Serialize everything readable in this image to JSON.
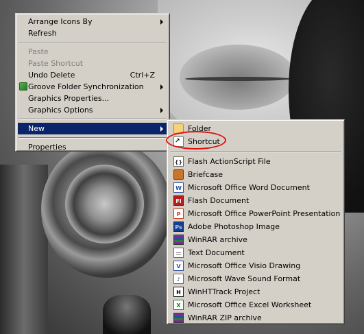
{
  "main_menu": {
    "items": [
      {
        "label": "Arrange Icons By",
        "submenu": true
      },
      {
        "label": "Refresh"
      },
      {
        "label": "Paste",
        "disabled": true
      },
      {
        "label": "Paste Shortcut",
        "disabled": true
      },
      {
        "label": "Undo Delete",
        "shortcut": "Ctrl+Z"
      },
      {
        "label": "Groove Folder Synchronization",
        "submenu": true,
        "icon": "groove-icon"
      },
      {
        "label": "Graphics Properties..."
      },
      {
        "label": "Graphics Options",
        "submenu": true
      },
      {
        "label": "New",
        "submenu": true,
        "selected": true
      },
      {
        "label": "Properties"
      }
    ]
  },
  "new_submenu": {
    "items": [
      {
        "label": "Folder",
        "icon": "folder-icon"
      },
      {
        "label": "Shortcut",
        "icon": "shortcut-icon",
        "highlighted_annotation": true
      },
      {
        "label": "Flash ActionScript File",
        "icon": "actionscript-file-icon"
      },
      {
        "label": "Briefcase",
        "icon": "briefcase-icon"
      },
      {
        "label": "Microsoft Office Word Document",
        "icon": "word-document-icon"
      },
      {
        "label": "Flash Document",
        "icon": "flash-document-icon"
      },
      {
        "label": "Microsoft Office PowerPoint Presentation",
        "icon": "powerpoint-icon"
      },
      {
        "label": "Adobe Photoshop Image",
        "icon": "photoshop-icon"
      },
      {
        "label": "WinRAR archive",
        "icon": "winrar-icon"
      },
      {
        "label": "Text Document",
        "icon": "text-document-icon"
      },
      {
        "label": "Microsoft Office Visio Drawing",
        "icon": "visio-icon"
      },
      {
        "label": "Microsoft Wave Sound Format",
        "icon": "wave-sound-icon"
      },
      {
        "label": "WinHTTrack Project",
        "icon": "httrack-icon"
      },
      {
        "label": "Microsoft Office Excel Worksheet",
        "icon": "excel-icon"
      },
      {
        "label": "WinRAR ZIP archive",
        "icon": "winrar-zip-icon"
      }
    ]
  },
  "icon_glyphs": {
    "actionscript": "{}",
    "word": "W",
    "flash": "Fl",
    "ppt": "P",
    "ps": "Ps",
    "visio": "V",
    "wave": "♪",
    "httrack": "H",
    "excel": "X"
  },
  "colors": {
    "menu_bg": "#d4d0c8",
    "selection": "#0a246a",
    "disabled_text": "#808080",
    "annotation": "#e01010"
  }
}
